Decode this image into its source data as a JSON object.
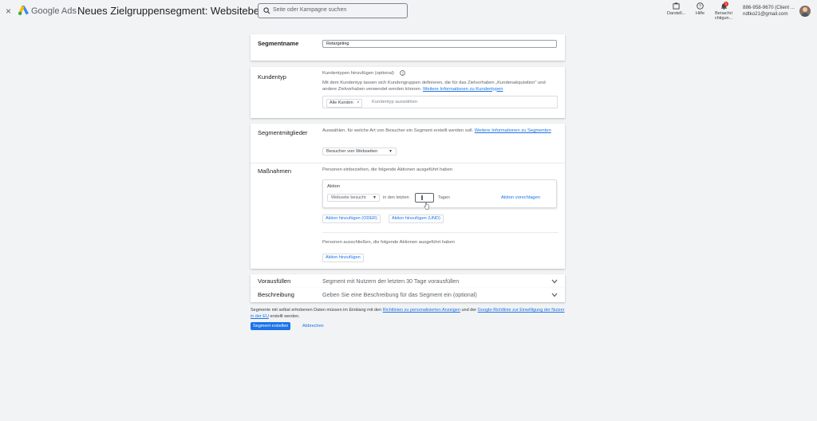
{
  "header": {
    "close": "×",
    "brand": "Google Ads",
    "title": "Neues Zielgruppensegment: Websitebesucher",
    "search_placeholder": "Seite oder Kampagne suchen",
    "tools": [
      {
        "label": "Darstell...",
        "icon": "appearance-icon"
      },
      {
        "label": "Hilfe",
        "icon": "help-icon"
      },
      {
        "label": "Benachri chtigun...",
        "icon": "bell-icon",
        "badge": "1"
      }
    ],
    "account_line1": "886-958-9670 (Client ...",
    "account_line2": "ndtko21@gmail.com"
  },
  "segment_name": {
    "label": "Segmentname",
    "value": "Retargeting"
  },
  "customer_type": {
    "label": "Kundentyp",
    "add_label": "Kundentypen hinzufügen (optional)",
    "description": "Mit dem Kundentyp lassen sich Kundengruppen definieren, die für das Zielvorhaben „Kundenakquisition“ und andere Zielvorhaben verwendet werden können.",
    "link": "Weitere Informationen zu Kundentypen",
    "chip": "Alle Kunden",
    "select_placeholder": "Kundentyp auswählen"
  },
  "members": {
    "label": "Segmentmitglieder",
    "description": "Auswählen, für welche Art von Besucher ein Segment erstellt werden soll.",
    "link": "Weitere Informationen zu Segmenten",
    "dropdown": "Besucher von Webseiten"
  },
  "actions": {
    "label": "Maßnahmen",
    "include_text": "Personen einbeziehen, die folgende Aktionen ausgeführt haben",
    "box_title": "Aktion",
    "action_select": "Webseite besucht",
    "in_last": "in den letzten",
    "days_value": "",
    "days_label": "Tagen",
    "suggest_link": "Aktion vorschlagen",
    "add_or": "Aktion hinzufügen (ODER)",
    "add_and": "Aktion hinzufügen (UND)",
    "exclude_text": "Personen ausschließen, die folgende Aktionen ausgeführt haben",
    "add_action": "Aktion hinzufügen"
  },
  "prefill": {
    "label": "Vorausfüllen",
    "value": "Segment mit Nutzern der letzten 30 Tage vorausfüllen"
  },
  "description_row": {
    "label": "Beschreibung",
    "value": "Geben Sie eine Beschreibung für das Segment ein (optional)"
  },
  "footer": {
    "note_start": "Segmente mit selbst erhobenen Daten müssen im Einklang mit den",
    "link1": "Richtlinien zu personalisierten Anzeigen",
    "note_mid": "und der",
    "link2": "Google-Richtlinie zur Einwilligung der Nutzer in der EU",
    "note_end": "erstellt werden.",
    "create_button": "Segment erstellen",
    "cancel_button": "Abbrechen"
  },
  "colors": {
    "accent": "#1a73e8",
    "background": "#f1f3f4",
    "card": "#ffffff",
    "badge": "#d93025"
  }
}
